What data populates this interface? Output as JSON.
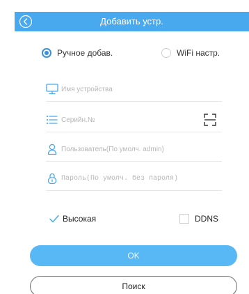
{
  "colors": {
    "accent": "#49a9ef",
    "button": "#58b7f5",
    "radio": "#3a90d8"
  },
  "header": {
    "title": "Добавить устр.",
    "back_icon": "chevron-left-circle-icon"
  },
  "mode": {
    "manual_label": "Ручное добав.",
    "wifi_label": "WiFi настр.",
    "selected": "manual"
  },
  "fields": {
    "name": {
      "icon": "monitor-icon",
      "value": "",
      "placeholder": "Имя устройства"
    },
    "serial": {
      "icon": "list-icon",
      "value": "",
      "placeholder": "Серийн.№",
      "scan_icon": "scan-icon"
    },
    "user": {
      "icon": "user-icon",
      "value": "",
      "placeholder": "Пользователь(По умолч. admin)"
    },
    "password": {
      "icon": "lock-icon",
      "value": "",
      "placeholder": "Пароль(По умолч. без пароля)"
    }
  },
  "options": {
    "high_label": "Высокая",
    "high_checked": true,
    "ddns_label": "DDNS",
    "ddns_checked": false
  },
  "buttons": {
    "ok_label": "OK",
    "search_label": "Поиск"
  }
}
